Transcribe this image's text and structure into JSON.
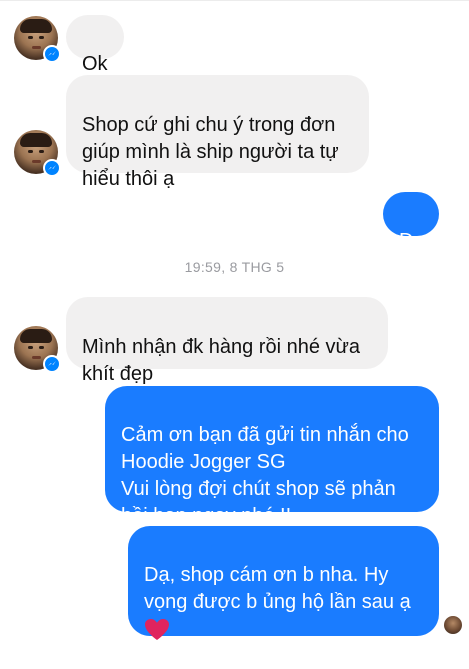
{
  "conversation": {
    "timestamp": "19:59, 8 THG 5",
    "messages": [
      {
        "direction": "in",
        "text": "Ok"
      },
      {
        "direction": "in",
        "text": "Shop cứ ghi chu ý trong đơn\ngiúp mình là ship người ta tự\nhiểu thôi ạ"
      },
      {
        "direction": "out",
        "text": "Dạ"
      },
      {
        "direction": "in",
        "text": "Mình nhận đk hàng rồi nhé vừa\nkhít đẹp"
      },
      {
        "direction": "out",
        "text": "Cảm ơn bạn đã gửi tin nhắn cho\nHoodie Jogger SG\nVui lòng đợi chút shop sẽ phản\nhồi bạn ngay nhé !!"
      },
      {
        "direction": "out",
        "text": "Dạ, shop cám ơn b nha. Hy\nvọng được b ủng hộ lần sau ạ",
        "emoji": "heart-icon"
      }
    ]
  },
  "colors": {
    "incoming_bubble": "#f1f0f0",
    "outgoing_bubble": "#1a7cff",
    "messenger_badge": "#0084ff",
    "timestamp_text": "#9a9ba0",
    "heart": "#e0245e"
  }
}
